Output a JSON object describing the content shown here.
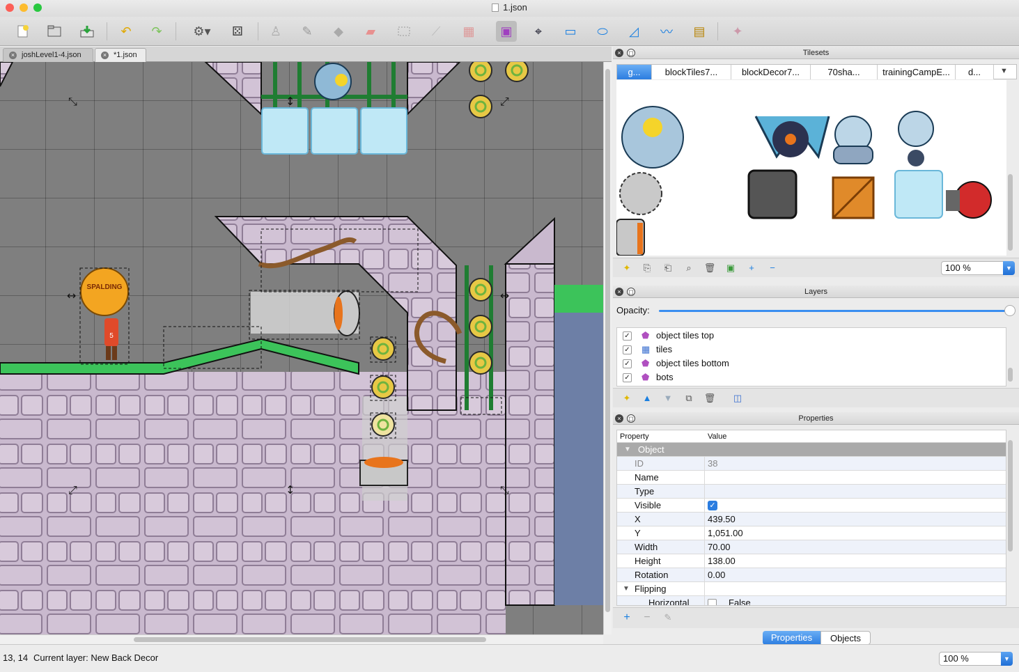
{
  "window": {
    "title": "1.json"
  },
  "toolbar": {
    "buttons": [
      "new-file",
      "open-file",
      "save-file",
      "undo",
      "redo",
      "random-mode",
      "dice",
      "stamp-brush",
      "terrain-brush",
      "bucket-fill",
      "eraser",
      "rect-select",
      "magic-wand",
      "select-same-tile",
      "select-objects",
      "edit-polygons",
      "insert-rectangle",
      "insert-ellipse",
      "insert-polygon",
      "insert-polyline",
      "insert-tile",
      "tile-animation"
    ]
  },
  "doc_tabs": [
    {
      "label": "joshLevel1-4.json",
      "active": false
    },
    {
      "label": "*1.json",
      "active": true
    }
  ],
  "tilesets": {
    "title": "Tilesets",
    "tabs": [
      "g...",
      "blockTiles7...",
      "blockDecor7...",
      "70sha...",
      "trainingCampE...",
      "d..."
    ],
    "zoom": "100 %"
  },
  "layers": {
    "title": "Layers",
    "opacity_label": "Opacity:",
    "opacity_value": 1.0,
    "items": [
      {
        "name": "object tiles top",
        "type": "object",
        "visible": true
      },
      {
        "name": "tiles",
        "type": "tile",
        "visible": true
      },
      {
        "name": "object tiles bottom",
        "type": "object",
        "visible": true
      },
      {
        "name": "bots",
        "type": "object",
        "visible": true
      }
    ]
  },
  "properties": {
    "title": "Properties",
    "col_property": "Property",
    "col_value": "Value",
    "group": "Object",
    "rows": [
      {
        "key": "ID",
        "value": "38"
      },
      {
        "key": "Name",
        "value": ""
      },
      {
        "key": "Type",
        "value": ""
      },
      {
        "key": "Visible",
        "value": "✓"
      },
      {
        "key": "X",
        "value": "439.50"
      },
      {
        "key": "Y",
        "value": "1,051.00"
      },
      {
        "key": "Width",
        "value": "70.00"
      },
      {
        "key": "Height",
        "value": "138.00"
      },
      {
        "key": "Rotation",
        "value": "0.00"
      }
    ],
    "flipping_label": "Flipping",
    "horizontal_label": "Horizontal",
    "horizontal_value": "False",
    "tab_properties": "Properties",
    "tab_objects": "Objects"
  },
  "status": {
    "coords": "13, 14",
    "current_layer": "Current layer: New Back Decor",
    "zoom": "100 %"
  },
  "canvas": {
    "ball_label": "SPALDING",
    "player_number": "5"
  },
  "colors": {
    "accent": "#2b7de0",
    "grid_bg": "#7f7f7f",
    "stone": "#c8b8cc",
    "grass": "#3cc35a",
    "water": "#6d7fa6"
  }
}
